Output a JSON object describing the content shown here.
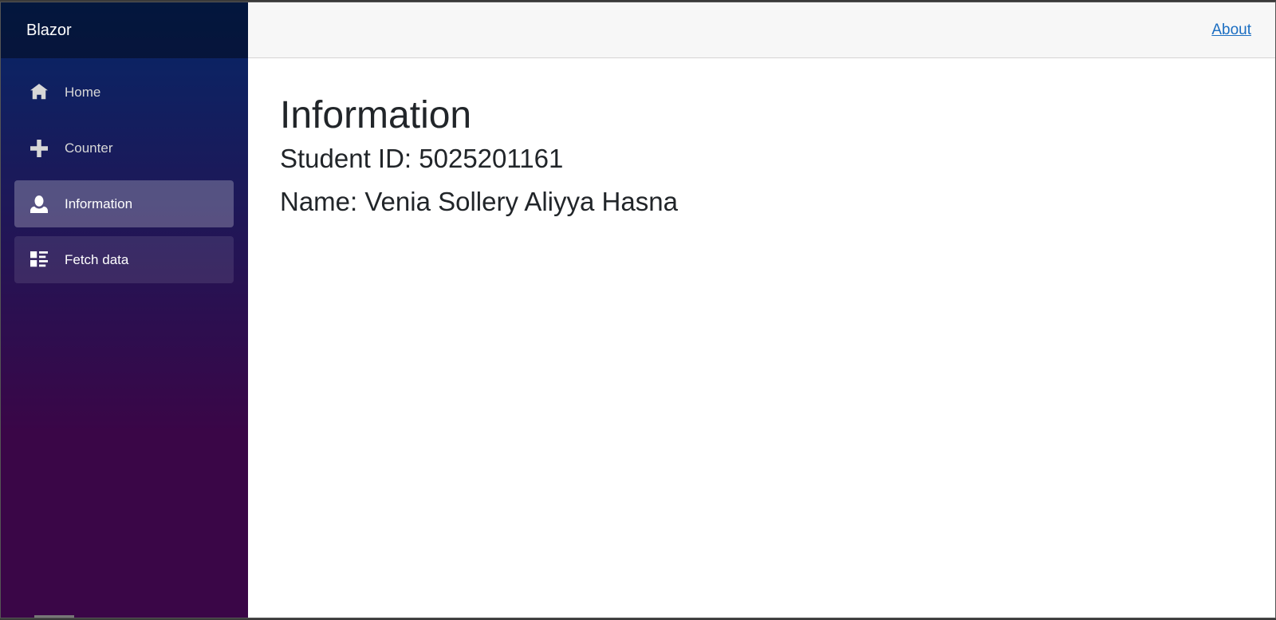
{
  "brand": {
    "title": "Blazor"
  },
  "sidebar": {
    "items": [
      {
        "label": "Home",
        "icon": "home-icon"
      },
      {
        "label": "Counter",
        "icon": "plus-icon"
      },
      {
        "label": "Information",
        "icon": "person-icon"
      },
      {
        "label": "Fetch data",
        "icon": "list-rich-icon"
      }
    ],
    "active": "Information",
    "gradient_top": "#052767",
    "gradient_bottom": "#3a0647"
  },
  "header": {
    "about_label": "About",
    "link_color": "#1b6ec2"
  },
  "main": {
    "title": "Information",
    "student_id": "Student ID: 5025201161",
    "name": "Name: Venia Sollery Aliyya Hasna"
  }
}
